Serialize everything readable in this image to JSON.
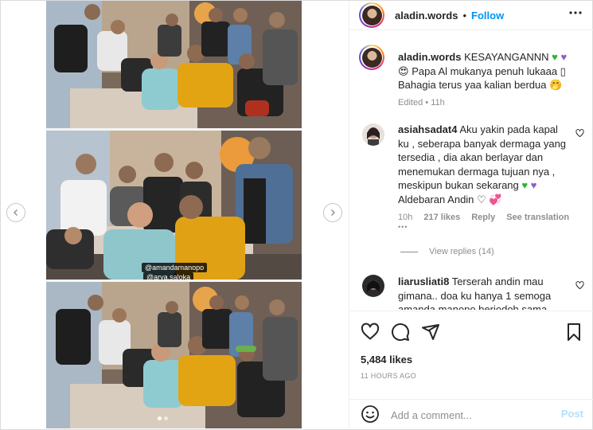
{
  "post": {
    "author": "aladin.words",
    "follow_label": "Follow",
    "separator": "•",
    "photo_tags": [
      "@amandamanopo",
      "@arya.saloka"
    ],
    "carousel": {
      "slides": 2,
      "active_index": 0
    }
  },
  "caption": {
    "username": "aladin.words",
    "line1": "KESAYANGANNN",
    "line1_emoji_1": "♥",
    "line1_emoji_2": "♥",
    "line2_emoji": "😍",
    "line2": "Papa Al mukanya penuh lukaaa ▯",
    "line3": "Bahagia terus yaa kalian berdua 🤭",
    "edited": "Edited",
    "time": "11h"
  },
  "comments": [
    {
      "username": "asiahsadat4",
      "text_lines": [
        "Aku yakin pada kapal",
        "ku , seberapa banyak dermaga yang",
        "tersedia , dia akan berlayar dan",
        "menemukan dermaga tujuan nya ,",
        "meskipun bukan sekarang"
      ],
      "tail": "Aldebaran Andin ♡",
      "tail_emoji": "💞",
      "time": "10h",
      "likes": "217 likes",
      "reply_label": "Reply",
      "translation_label": "See translation",
      "more_label": "•••",
      "view_replies": "View replies (14)"
    },
    {
      "username": "liarusliati8",
      "text_lines": [
        "Terserah andin mau",
        "gimana.. doa ku hanya 1 semoga",
        "amanda manopo berjodoh sama"
      ]
    }
  ],
  "stats": {
    "likes": "5,484 likes",
    "posted": "11 HOURS AGO"
  },
  "composer": {
    "placeholder": "Add a comment...",
    "post_label": "Post"
  },
  "colors": {
    "link_blue": "#0095f6",
    "post_disabled": "#b2dffc",
    "meta_gray": "#8e8e8e",
    "heart_green": "#2bb62b",
    "heart_purple": "#8a5cd6"
  },
  "icons": [
    "chevron-left-icon",
    "chevron-right-icon",
    "more-horizontal-icon",
    "heart-icon",
    "comment-icon",
    "share-icon",
    "bookmark-icon",
    "emoji-icon"
  ]
}
